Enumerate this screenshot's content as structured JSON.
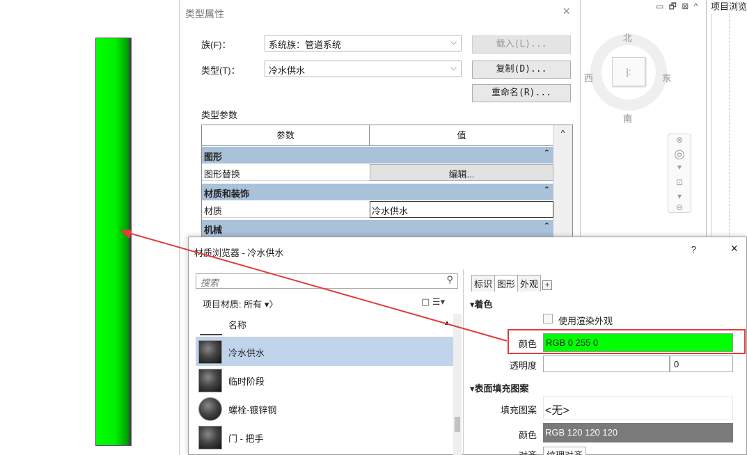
{
  "type_dialog": {
    "title": "类型属性",
    "close": "×",
    "family_label": "族(F)：",
    "family_value": "系统族：管道系统",
    "type_label": "类型(T)：",
    "type_value": "冷水供水",
    "load_button": "载入(L)...",
    "duplicate_button": "复制(D)...",
    "rename_button": "重命名(R)...",
    "section_title": "类型参数",
    "grid": {
      "col_param": "参数",
      "col_value": "值",
      "groups": [
        {
          "name": "图形",
          "chevron": "⌃"
        },
        {
          "name": "材质和装饰",
          "chevron": "⌃"
        },
        {
          "name": "机械",
          "chevron": "⌃"
        }
      ],
      "rows": [
        {
          "param": "图形替换",
          "value": "编辑..."
        },
        {
          "param": "材质",
          "value": "冷水供水"
        }
      ],
      "scroll_up": "^"
    }
  },
  "viewcube": {
    "north": "北",
    "south": "南",
    "east": "东",
    "west": "西",
    "face": "|:"
  },
  "window_controls": "▭ 🗗 ⊠ ^",
  "project_browser": {
    "title": "项目浏览"
  },
  "material_browser": {
    "title": "材质浏览器 - 冷水供水",
    "help": "?",
    "close": "×",
    "search_placeholder": "搜索",
    "library_label": "项目材质: 所有",
    "list_header": "名称",
    "materials": [
      {
        "name": "冷水供水",
        "selected": true
      },
      {
        "name": "临时阶段",
        "selected": false
      },
      {
        "name": "螺栓-镀锌钢",
        "selected": false
      },
      {
        "name": "门 - 把手",
        "selected": false
      }
    ],
    "tabs": [
      "标识",
      "图形",
      "外观",
      "+"
    ],
    "active_tab": "图形",
    "shading_section": "▾着色",
    "use_render_label": "使用渲染外观",
    "color_label": "颜色",
    "color_value": "RGB 0 255 0",
    "color_hex": "#00ff00",
    "transparency_label": "透明度",
    "transparency_value": "0",
    "surface_section": "▾表面填充图案",
    "pattern_label": "填充图案",
    "pattern_value": "<无>",
    "surface_color_label": "颜色",
    "surface_color_value": "RGB 120 120 120",
    "surface_color_hex": "#787878",
    "align_label": "对齐",
    "align_value": "纹理对齐"
  },
  "annotation_color": "#e23b3b"
}
